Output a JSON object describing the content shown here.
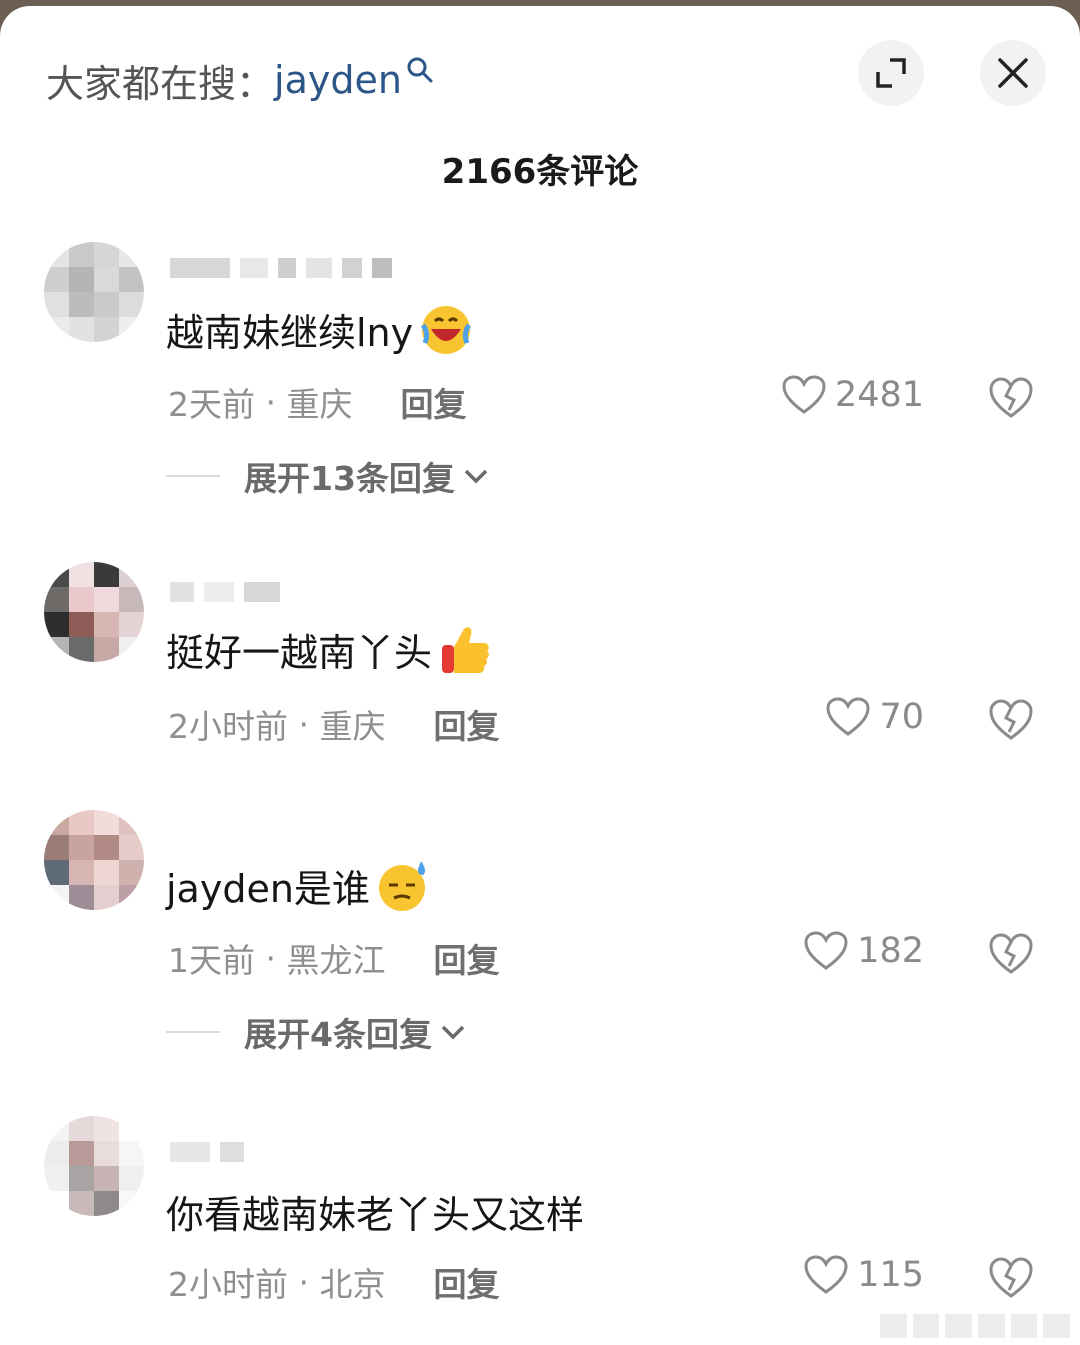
{
  "search": {
    "prefix": "大家都在搜：",
    "term": "jayden"
  },
  "header": {
    "comment_count": "2166条评论"
  },
  "comments": [
    {
      "text": "越南妹继续lny",
      "emoji": "grinning-sweat-tears-emoji",
      "time": "2天前",
      "location": "重庆",
      "reply_label": "回复",
      "likes": "2481",
      "expand_label": "展开13条回复"
    },
    {
      "text": "挺好一越南丫头",
      "emoji": "thumbs-up-emoji",
      "time": "2小时前",
      "location": "重庆",
      "reply_label": "回复",
      "likes": "70"
    },
    {
      "text": "jayden是谁",
      "emoji": "sweat-smile-emoji",
      "time": "1天前",
      "location": "黑龙江",
      "reply_label": "回复",
      "likes": "182",
      "expand_label": "展开4条回复"
    },
    {
      "text": "你看越南妹老丫头又这样",
      "time": "2小时前",
      "location": "北京",
      "reply_label": "回复",
      "likes": "115"
    }
  ],
  "colors": {
    "accent_link": "#2c5687",
    "meta_gray": "#8f8f8f",
    "text_dark": "#161616"
  }
}
